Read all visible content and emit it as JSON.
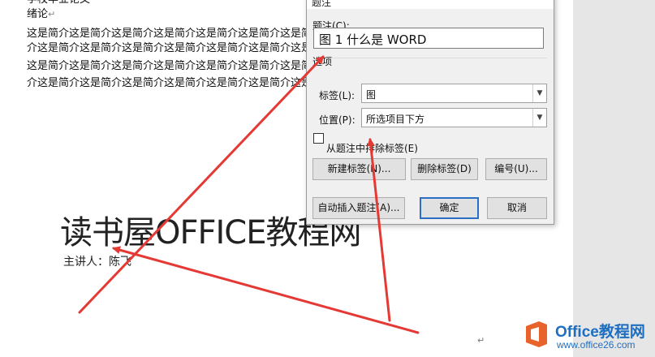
{
  "document": {
    "top_cut_line": "学校毕业论文",
    "heading": "绪论",
    "paragraph_lines": [
      "这是简介这是简介这是简介这是简介这是简介这是简介这是简",
      "介这是简介这是简介这是简介这是简介这是简介这是简介这是简",
      "这是简介这是简介这是简介这是简介这是简介这是简介这是简介",
      "介这是简介这是简介这是简介这是简介这是简介这是简介这是简"
    ],
    "big_title": "读书屋OFFICE教程网",
    "author": "主讲人：陈飞",
    "paragraph_mark": "↵"
  },
  "dialog": {
    "title": "题注",
    "caption_label": "题注(C):",
    "caption_value": "图 1 什么是 WORD",
    "options_label": "选项",
    "tag_label": "标签(L):",
    "tag_value": "图",
    "position_label": "位置(P):",
    "position_value": "所选项目下方",
    "exclude_label": "从题注中排除标签(E)",
    "exclude_checked": false,
    "buttons": {
      "new_label": "新建标签(N)...",
      "delete_label": "删除标签(D)",
      "numbering": "编号(U)...",
      "auto_insert": "自动插入题注(A)...",
      "ok": "确定",
      "cancel": "取消"
    }
  },
  "watermark": {
    "brand": "Office教程网",
    "url": "www.office26.com"
  },
  "colors": {
    "arrow": "#e53935",
    "brand": "#1f6fc1",
    "logo": "#e8632b"
  }
}
